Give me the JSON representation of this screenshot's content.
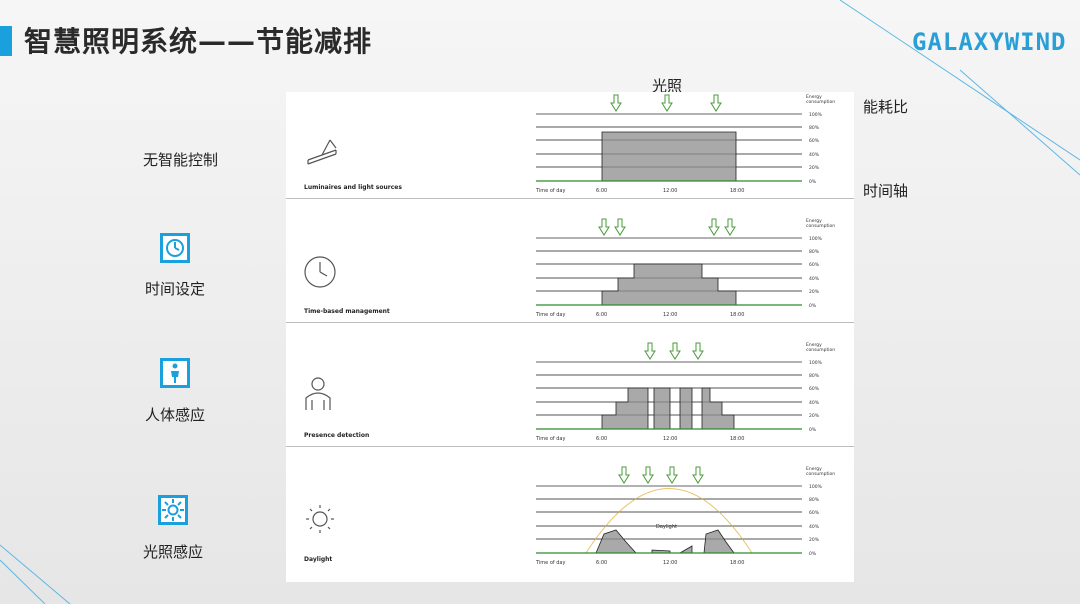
{
  "slide": {
    "title": "智慧照明系统——节能减排",
    "logo": "GALAXYWIND",
    "accent_color": "#1aa0dc"
  },
  "annotations": {
    "light": "光照",
    "energy_ratio": "能耗比",
    "time_axis": "时间轴"
  },
  "modes": [
    {
      "label": "无智能控制",
      "icon": "none",
      "caption": "Luminaires and light sources",
      "glyph": "ceiling-lamp-icon"
    },
    {
      "label": "时间设定",
      "icon": "clock-icon",
      "caption": "Time-based management",
      "glyph": "clock-icon"
    },
    {
      "label": "人体感应",
      "icon": "person-icon",
      "caption": "Presence detection",
      "glyph": "person-icon"
    },
    {
      "label": "光照感应",
      "icon": "sun-icon",
      "caption": "Daylight",
      "glyph": "sun-icon"
    }
  ],
  "chart_common": {
    "y_title_line1": "Energy",
    "y_title_line2": "consumption",
    "y_ticks": [
      "100%",
      "80%",
      "60%",
      "40%",
      "20%",
      "0%"
    ],
    "x_title": "Time of day",
    "x_ticks": [
      "6:00",
      "12:00",
      "18:00"
    ],
    "daylight_label": "Daylight"
  }
}
